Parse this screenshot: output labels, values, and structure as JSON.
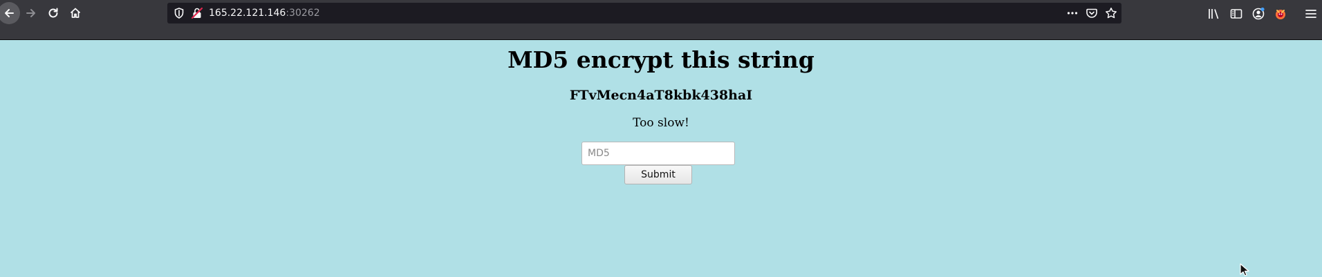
{
  "browser": {
    "url_host": "165.22.121.146",
    "url_port": ":30262"
  },
  "page": {
    "title": "MD5 encrypt this string",
    "challenge_string": "FTvMecn4aT8kbk438haI",
    "status": "Too slow!",
    "input_placeholder": "MD5",
    "input_value": "",
    "submit_label": "Submit"
  },
  "colors": {
    "page_background": "#b0e0e6",
    "toolbar_background": "#38383d",
    "urlbar_background": "#1c1b22"
  },
  "icons": [
    "back-arrow-icon",
    "forward-arrow-icon",
    "reload-icon",
    "home-icon",
    "shield-icon",
    "insecure-lock-icon",
    "more-actions-icon",
    "pocket-icon",
    "bookmark-star-icon",
    "library-icon",
    "sidebar-icon",
    "account-icon",
    "extension-icon",
    "menu-icon"
  ]
}
